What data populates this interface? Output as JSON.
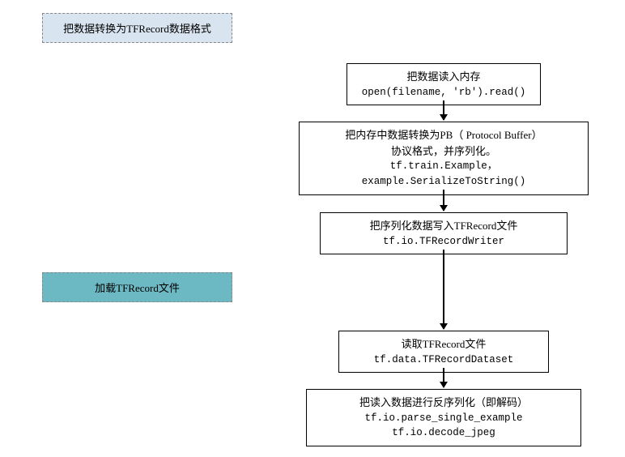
{
  "sections": {
    "convert": {
      "label": "把数据转换为TFRecord数据格式"
    },
    "load": {
      "label": "加载TFRecord文件"
    }
  },
  "boxes": {
    "b1": {
      "title": "把数据读入内存",
      "code1": "open(filename, 'rb').read()"
    },
    "b2": {
      "title_l1": "把内存中数据转换为PB（ Protocol Buffer）",
      "title_l2": "协议格式，并序列化。",
      "code1": "tf.train.Example，",
      "code2": "example.SerializeToString()"
    },
    "b3": {
      "title": "把序列化数据写入TFRecord文件",
      "code1": "tf.io.TFRecordWriter"
    },
    "b4": {
      "title": "读取TFRecord文件",
      "code1": "tf.data.TFRecordDataset"
    },
    "b5": {
      "title": "把读入数据进行反序列化（即解码）",
      "code1": "tf.io.parse_single_example",
      "code2": "tf.io.decode_jpeg"
    }
  },
  "chart_data": {
    "type": "flowchart",
    "nodes": [
      {
        "id": "section_convert",
        "type": "section_label",
        "text": "把数据转换为TFRecord数据格式"
      },
      {
        "id": "n1",
        "type": "process",
        "text": "把数据读入内存",
        "api": "open(filename, 'rb').read()"
      },
      {
        "id": "n2",
        "type": "process",
        "text": "把内存中数据转换为PB（ Protocol Buffer）协议格式，并序列化。",
        "api": "tf.train.Example, example.SerializeToString()"
      },
      {
        "id": "n3",
        "type": "process",
        "text": "把序列化数据写入TFRecord文件",
        "api": "tf.io.TFRecordWriter"
      },
      {
        "id": "section_load",
        "type": "section_label",
        "text": "加载TFRecord文件"
      },
      {
        "id": "n4",
        "type": "process",
        "text": "读取TFRecord文件",
        "api": "tf.data.TFRecordDataset"
      },
      {
        "id": "n5",
        "type": "process",
        "text": "把读入数据进行反序列化（即解码）",
        "api": "tf.io.parse_single_example, tf.io.decode_jpeg"
      }
    ],
    "edges": [
      {
        "from": "n1",
        "to": "n2"
      },
      {
        "from": "n2",
        "to": "n3"
      },
      {
        "from": "n3",
        "to": "n4"
      },
      {
        "from": "n4",
        "to": "n5"
      }
    ]
  }
}
